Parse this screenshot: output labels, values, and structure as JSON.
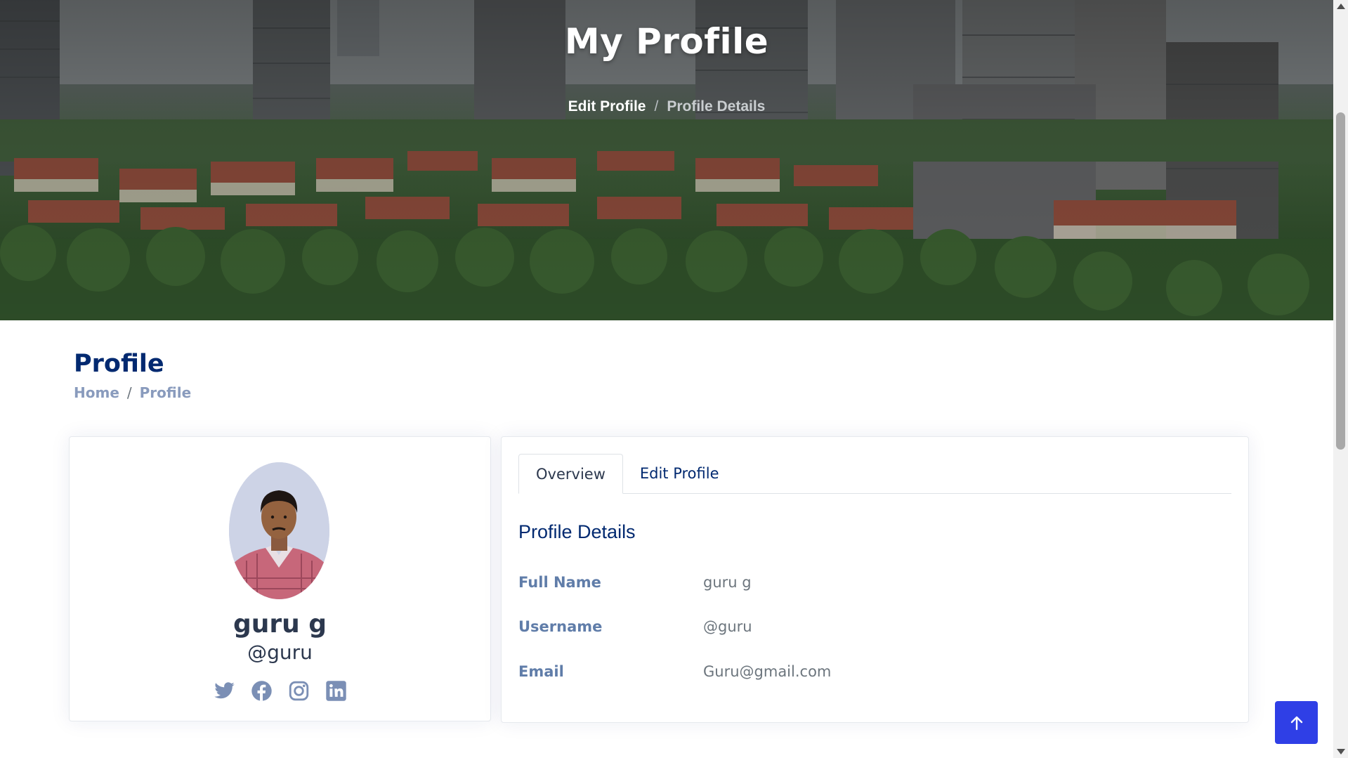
{
  "hero": {
    "title": "My Profile",
    "breadcrumb": {
      "first": "Edit Profile",
      "separator": "/",
      "second": "Profile Details"
    }
  },
  "page": {
    "title": "Profile",
    "breadcrumb": {
      "home": "Home",
      "separator": "/",
      "current": "Profile"
    }
  },
  "profile_card": {
    "name": "guru g",
    "handle": "@guru",
    "avatar_icon": "avatar-photo",
    "socials": [
      "twitter-icon",
      "facebook-icon",
      "instagram-icon",
      "linkedin-icon"
    ],
    "social_color": "#7b8fb5"
  },
  "details_card": {
    "tabs": [
      {
        "label": "Overview",
        "active": true
      },
      {
        "label": "Edit Profile",
        "active": false
      }
    ],
    "section_title": "Profile Details",
    "fields": [
      {
        "label": "Full Name",
        "value": "guru g"
      },
      {
        "label": "Username",
        "value": "@guru"
      },
      {
        "label": "Email",
        "value": "Guru@gmail.com"
      }
    ]
  },
  "back_to_top": {
    "icon": "arrow-up-icon",
    "color": "#2f3fe6"
  },
  "colors": {
    "heading": "#012970",
    "muted": "#899bbd"
  }
}
